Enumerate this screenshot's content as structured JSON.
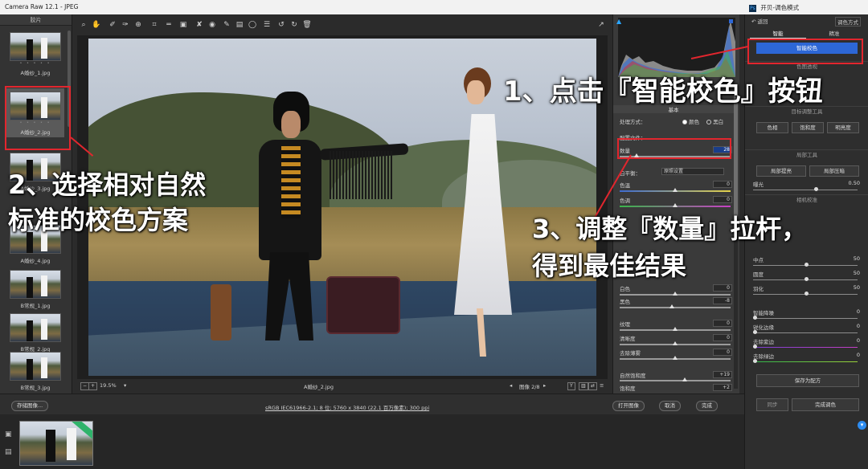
{
  "window": {
    "title": "Camera Raw 12.1 - JPEG",
    "ps_title": "开贝-调色模式"
  },
  "filmstrip": {
    "header": "胶片",
    "items": [
      {
        "label": "A婚纱_1.jpg",
        "selected": false
      },
      {
        "label": "A婚纱_2.jpg",
        "selected": true
      },
      {
        "label": "A婚纱_3.jpg",
        "selected": false
      },
      {
        "label": "A婚纱_4.jpg",
        "selected": false
      },
      {
        "label": "B常规_1.jpg",
        "selected": false
      },
      {
        "label": "B常规_2.jpg",
        "selected": false
      },
      {
        "label": "B常规_3.jpg",
        "selected": false
      }
    ],
    "stars": "• • • • •"
  },
  "toolbar": {
    "icons": [
      "zoom-icon",
      "hand-icon",
      "white-balance-icon",
      "color-sampler-icon",
      "target-adjust-icon",
      "crop-icon",
      "straighten-icon",
      "transform-icon",
      "spot-removal-icon",
      "red-eye-icon",
      "brush-icon",
      "graduated-filter-icon",
      "radial-filter-icon",
      "preferences-icon",
      "rotate-left-icon",
      "rotate-right-icon",
      "trash-icon"
    ]
  },
  "canvas": {
    "zoom": "19.5%",
    "filename": "A婚纱_2.jpg",
    "image_counter": "图像 2/8"
  },
  "basic_panel": {
    "section_title": "基本",
    "process_label": "处理方式：",
    "process_color": "颜色",
    "process_bw": "黑白",
    "profile_label": "配置文件：",
    "amount_label": "数量",
    "amount_value": "28",
    "white_balance_label": "白平衡：",
    "white_balance_value": "原照设置",
    "sliders": [
      {
        "label": "色温",
        "value": "0"
      },
      {
        "label": "色调",
        "value": "0"
      },
      {
        "label": "白色",
        "value": "0"
      },
      {
        "label": "黑色",
        "value": "-8"
      },
      {
        "label": "纹理",
        "value": "0"
      },
      {
        "label": "清晰度",
        "value": "0"
      },
      {
        "label": "去除薄雾",
        "value": "0"
      },
      {
        "label": "自然饱和度",
        "value": "+19"
      },
      {
        "label": "饱和度",
        "value": "+2"
      }
    ]
  },
  "ps_panel": {
    "back": "返回",
    "right_link": "调色方式",
    "tabs": [
      "智能",
      "精准"
    ],
    "smart_color_button": "智能校色",
    "section_scene": "色图透视",
    "section_target": "目标调整工具",
    "tone_buttons": [
      "色相",
      "饱和度",
      "明亮度"
    ],
    "section_local": "局部工具",
    "local_buttons": [
      "局部提亮",
      "局部压暗"
    ],
    "exposure_label": "曝光",
    "exposure_value": "0.50",
    "section_camera": "相机校准",
    "sliders": [
      {
        "label": "中点",
        "value": "50"
      },
      {
        "label": "圆度",
        "value": "50"
      },
      {
        "label": "羽化",
        "value": "50"
      },
      {
        "label": "智能降噪",
        "value": "0"
      },
      {
        "label": "锐化边缘",
        "value": "0"
      },
      {
        "label": "去除紫边",
        "value": "0"
      },
      {
        "label": "去除绿边",
        "value": "0"
      }
    ],
    "save_preset": "保存为配方",
    "sync": "同步",
    "done": "完成调色"
  },
  "bottom_bar": {
    "save_button": "存储图像...",
    "info": "sRGB IEC61966-2.1; 8 位; 5760 x 3840 (22.1 百万像素); 300 ppi",
    "open_button": "打开图像",
    "cancel_button": "取消",
    "done_button": "完成"
  },
  "annotations": {
    "step1": "1、点击『智能校色』按钮",
    "step2_line1": "2、选择相对自然",
    "step2_line2": "标准的校色方案",
    "step3_line1": "3、调整『数量』拉杆，",
    "step3_line2": "得到最佳结果"
  },
  "colors": {
    "accent_red": "#e2262e",
    "primary_blue": "#2d67d6",
    "background": "#2b2b2b"
  }
}
